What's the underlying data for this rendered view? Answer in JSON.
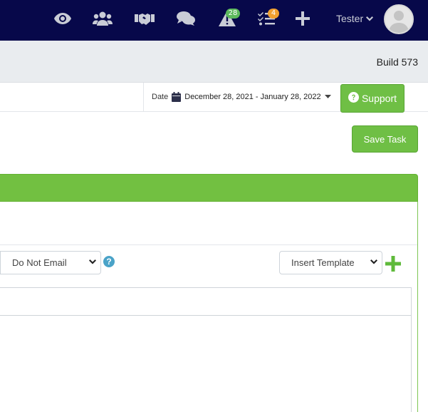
{
  "topnav": {
    "icons": [
      "eye-icon",
      "users-icon",
      "handshake-icon",
      "comments-icon",
      "alert-triangle-icon",
      "task-list-icon",
      "plus-icon"
    ],
    "alerts_badge": "28",
    "tasks_badge": "4",
    "user_name": "Tester"
  },
  "build": {
    "label": "Build 573"
  },
  "toolbar": {
    "date_label": "Date",
    "date_range": "December 28, 2021 - January 28, 2022",
    "support_label": "Support"
  },
  "actions": {
    "save_label": "Save Task"
  },
  "form": {
    "email_select_value": "Do Not Email",
    "help_glyph": "?",
    "template_select_value": "Insert Template"
  },
  "colors": {
    "nav_bg": "#07084a",
    "accent_green": "#72c041",
    "badge_green": "#5cb85c",
    "badge_orange": "#f0a030",
    "help_blue": "#4aa3c8"
  }
}
